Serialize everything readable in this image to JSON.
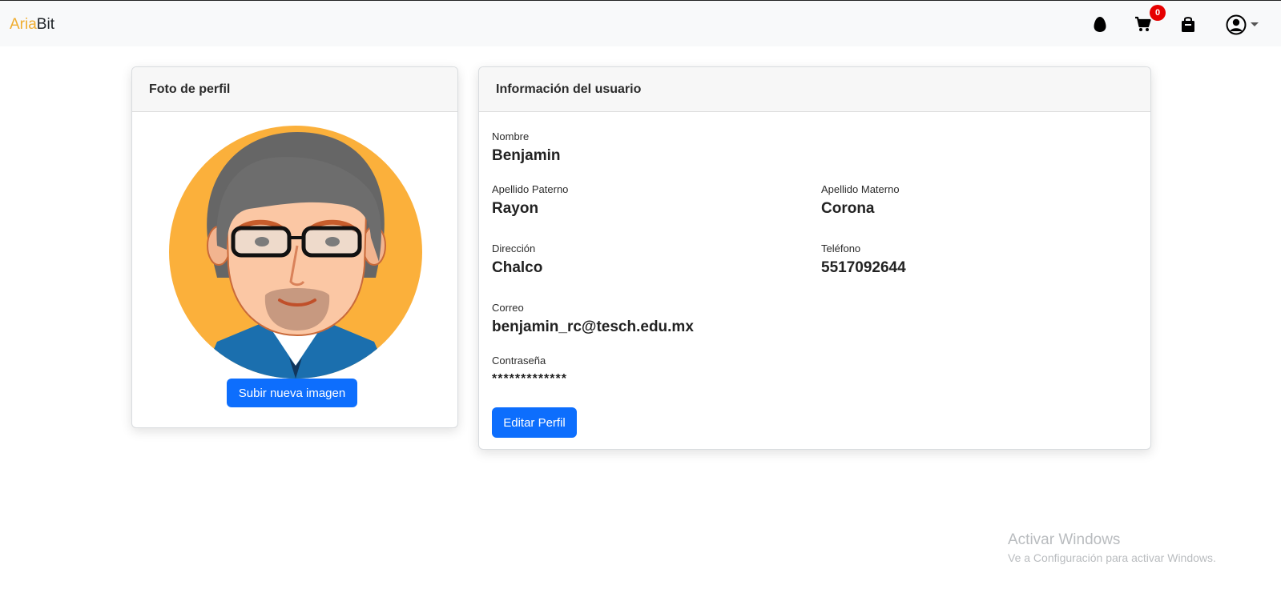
{
  "navbar": {
    "brand_part1": "Aria",
    "brand_part2": "Bit",
    "cart_count": "0",
    "icons": [
      "egg-icon",
      "cart-icon",
      "shopping-bag-icon",
      "user-circle-icon",
      "caret-down-icon"
    ]
  },
  "photo_card": {
    "title": "Foto de perfil",
    "upload_button": "Subir nueva imagen"
  },
  "info_card": {
    "title": "Información del usuario",
    "fields": {
      "nombre": {
        "label": "Nombre",
        "value": "Benjamin"
      },
      "apellido_paterno": {
        "label": "Apellido Paterno",
        "value": "Rayon"
      },
      "apellido_materno": {
        "label": "Apellido Materno",
        "value": "Corona"
      },
      "direccion": {
        "label": "Dirección",
        "value": "Chalco"
      },
      "telefono": {
        "label": "Teléfono",
        "value": "5517092644"
      },
      "correo": {
        "label": "Correo",
        "value": "benjamin_rc@tesch.edu.mx"
      },
      "contrasena": {
        "label": "Contraseña",
        "value": "*************"
      }
    },
    "edit_button": "Editar Perfil"
  },
  "watermark": {
    "line1": "Activar Windows",
    "line2": "Ve a Configuración para activar Windows."
  },
  "colors": {
    "accent": "#0d6efd",
    "brand_orange": "#f0ad2e",
    "badge_red": "#e60000",
    "navbar_bg": "#f8f9fa"
  }
}
